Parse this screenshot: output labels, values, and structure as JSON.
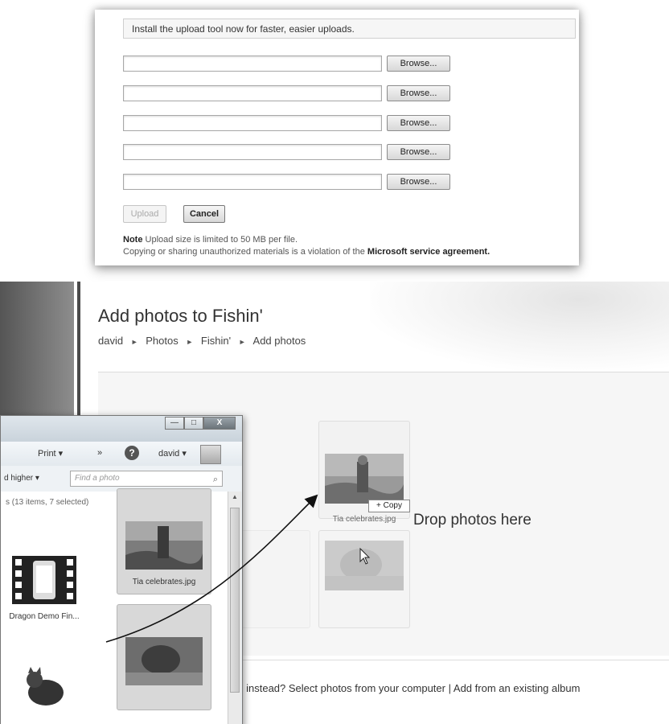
{
  "upload_dialog": {
    "install_message": "Install the upload tool now for faster, easier uploads.",
    "browse_label": "Browse...",
    "file_rows": [
      {
        "value": ""
      },
      {
        "value": ""
      },
      {
        "value": ""
      },
      {
        "value": ""
      },
      {
        "value": ""
      }
    ],
    "upload_label": "Upload",
    "cancel_label": "Cancel",
    "note_label": "Note",
    "note_text": "Upload size is limited to 50 MB per file.",
    "agreement_prefix": "Copying or sharing unauthorized materials is a violation of the",
    "agreement_link": "Microsoft service agreement."
  },
  "page": {
    "title": "Add photos to Fishin'",
    "breadcrumb": [
      "david",
      "Photos",
      "Fishin'",
      "Add photos"
    ],
    "drop_text": "Drop photos here",
    "copy_tooltip": "+ Copy",
    "tiles": [
      {
        "caption": "Tia celebrates.jpg"
      },
      {
        "caption": ""
      }
    ],
    "footer_prefix": "s instead?",
    "footer_link1": "Select photos from your computer",
    "footer_sep": "|",
    "footer_link2": "Add from an existing album"
  },
  "explorer": {
    "window_buttons": [
      "—",
      "□",
      "X"
    ],
    "toolbar": {
      "print": "Print ▾",
      "more": "»",
      "help_icon": "?",
      "user": "david ▾"
    },
    "filter_label": "d higher ▾",
    "search_placeholder": "Find a photo",
    "count_text": "s (13 items, 7 selected)",
    "thumbnails": [
      {
        "label": "Dragon Demo Fin...",
        "selected": false
      },
      {
        "label": "Tia celebrates.jpg",
        "selected": true
      },
      {
        "label": "",
        "selected": false
      },
      {
        "label": "",
        "selected": true
      }
    ]
  },
  "colors": {
    "accent_dark": "#333333",
    "drop_area_bg": "#f6f6f6",
    "selection_bg": "#d8d8d8"
  }
}
